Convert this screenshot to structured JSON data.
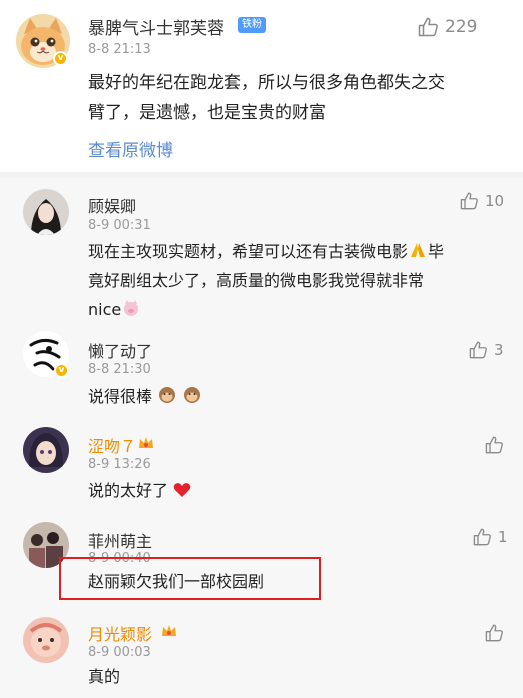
{
  "main_comment": {
    "name": "暴脾气斗士郭芙蓉",
    "fan_badge": "铁粉",
    "time": "8-8 21:13",
    "likes": "229",
    "text_line1": "最好的年纪在跑龙套，所以与很多角色都失之交",
    "text_line2": "臂了，是遗憾，也是宝贵的财富",
    "view_original": "查看原微博"
  },
  "replies": [
    {
      "name": "顾娱卿",
      "time": "8-9 00:31",
      "likes": "10",
      "line1": "现在主攻现实题材，希望可以还有古装微电影",
      "line1b": "毕",
      "line2": "竟好剧组太少了，高质量的微电影我觉得就非常",
      "line3": "nice"
    },
    {
      "name": "懒了动了",
      "time": "8-8 21:30",
      "likes": "3",
      "text": "说得很棒"
    },
    {
      "name": "涩吻７",
      "time": "8-9 13:26",
      "likes": "",
      "text": "说的太好了"
    },
    {
      "name": "菲州萌主",
      "time": "8-9 00:40",
      "likes": "1",
      "text": "赵丽颖欠我们一部校园剧"
    },
    {
      "name": "月光颖影",
      "time": "8-9 00:03",
      "likes": "",
      "text": "真的"
    }
  ],
  "colors": {
    "link": "#5b8ad1",
    "highlight": "#e02020",
    "vip_name": "#f08a00",
    "fan_badge": "#4f9bf7"
  }
}
